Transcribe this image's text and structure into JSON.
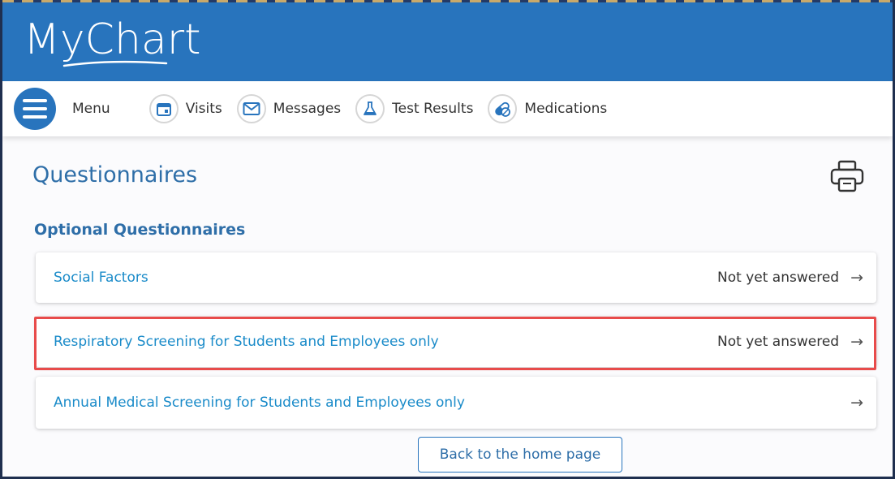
{
  "app": {
    "logo_text": "MyChart",
    "brand_color": "#2874bd",
    "highlight_color": "#e84b4b"
  },
  "nav": {
    "menu_label": "Menu",
    "items": [
      {
        "label": "Visits",
        "icon": "calendar-icon"
      },
      {
        "label": "Messages",
        "icon": "envelope-icon"
      },
      {
        "label": "Test Results",
        "icon": "flask-icon"
      },
      {
        "label": "Medications",
        "icon": "pill-icon"
      }
    ]
  },
  "page": {
    "title": "Questionnaires",
    "print_icon": "printer-icon",
    "section_title": "Optional Questionnaires"
  },
  "questionnaires": [
    {
      "name": "Social Factors",
      "status": "Not yet answered"
    },
    {
      "name": "Respiratory Screening for Students and Employees only",
      "status": "Not yet answered"
    },
    {
      "name": "Annual Medical Screening for Students and Employees only",
      "status": ""
    }
  ],
  "arrow_glyph": "→",
  "footer": {
    "back_label": "Back to the home page"
  }
}
